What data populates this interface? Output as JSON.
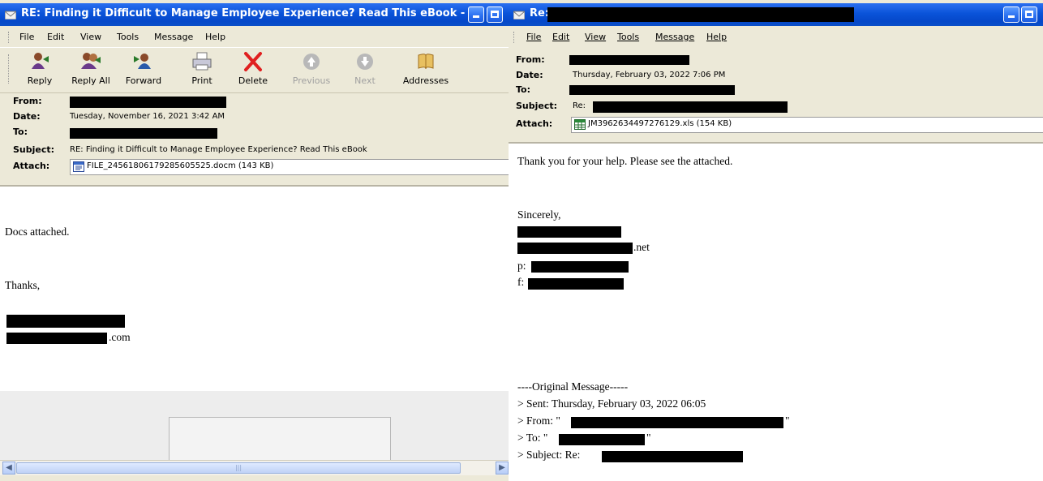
{
  "left_window": {
    "title": "RE: Finding it Difficult to Manage Employee Experience? Read This eBook - ...",
    "menu": [
      "File",
      "Edit",
      "View",
      "Tools",
      "Message",
      "Help"
    ],
    "toolbar": [
      {
        "label": "Reply",
        "icon": "reply-icon",
        "enabled": true
      },
      {
        "label": "Reply All",
        "icon": "reply-all-icon",
        "enabled": true
      },
      {
        "label": "Forward",
        "icon": "forward-icon",
        "enabled": true
      },
      {
        "label": "Print",
        "icon": "print-icon",
        "enabled": true
      },
      {
        "label": "Delete",
        "icon": "delete-icon",
        "enabled": true
      },
      {
        "label": "Previous",
        "icon": "previous-icon",
        "enabled": false
      },
      {
        "label": "Next",
        "icon": "next-icon",
        "enabled": false
      },
      {
        "label": "Addresses",
        "icon": "addresses-icon",
        "enabled": true
      }
    ],
    "header": {
      "from_label": "From:",
      "date_label": "Date:",
      "date_value": "Tuesday, November 16, 2021 3:42 AM",
      "to_label": "To:",
      "subject_label": "Subject:",
      "subject_value": "RE: Finding it Difficult to Manage Employee Experience? Read This eBook",
      "attach_label": "Attach:",
      "attachment": "FILE_24561806179285605525.docm (143 KB)"
    },
    "body": {
      "line1": "Docs attached.",
      "line2": "Thanks,",
      "email_suffix": ".com"
    }
  },
  "right_window": {
    "title": "Re:",
    "menu": [
      "File",
      "Edit",
      "View",
      "Tools",
      "Message",
      "Help"
    ],
    "header": {
      "from_label": "From:",
      "date_label": "Date:",
      "date_value": "Thursday, February 03, 2022 7:06 PM",
      "to_label": "To:",
      "subject_label": "Subject:",
      "subject_value": "Re:",
      "attach_label": "Attach:",
      "attachment": "JM3962634497276129.xls (154 KB)"
    },
    "body": {
      "line1": "Thank you for your help. Please see the attached.",
      "sincerely": "Sincerely,",
      "email_suffix": ".net",
      "phone_prefix": "p:",
      "fax_prefix": "f:",
      "orig_header": "----Original Message-----",
      "orig_sent": "> Sent: Thursday, February 03, 2022 06:05",
      "orig_from": "> From: \"",
      "orig_from_end": "\"",
      "orig_to": "> To: \"",
      "orig_to_end": "\"",
      "orig_subject": "> Subject: Re:"
    }
  },
  "colors": {
    "titlebar": "#0a53d9",
    "chrome": "#ece9d8",
    "redaction": "#000000"
  }
}
